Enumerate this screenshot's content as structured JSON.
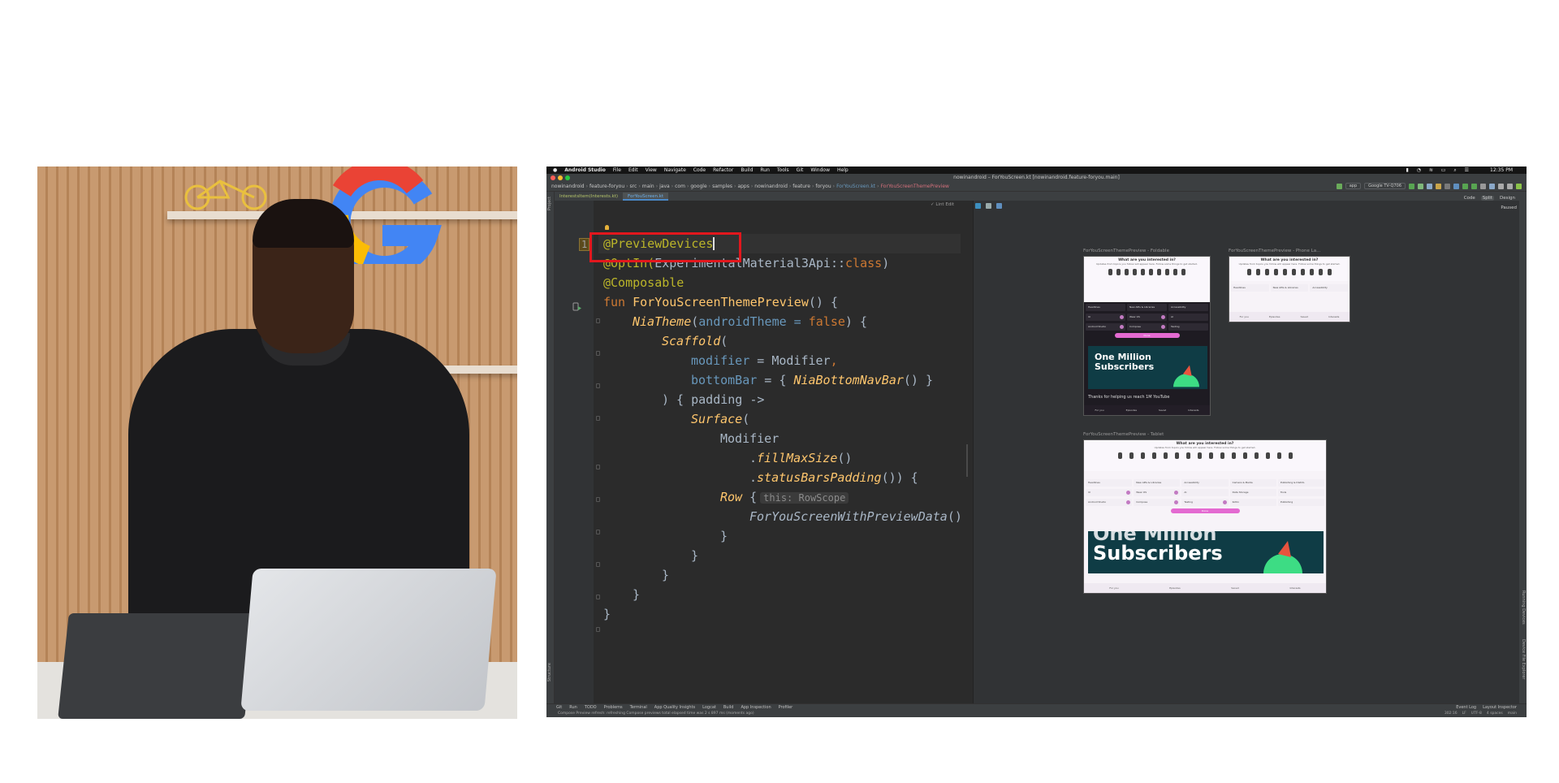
{
  "presenter": {
    "alt": "Presenter standing at a laptop in front of a wooden shelf with a Google logo"
  },
  "menubar": {
    "app": "Android Studio",
    "items": [
      "File",
      "Edit",
      "View",
      "Navigate",
      "Code",
      "Refactor",
      "Build",
      "Run",
      "Tools",
      "Git",
      "Window",
      "Help"
    ],
    "clock": "12:35 PM"
  },
  "window": {
    "title": "nowinandroid – ForYouScreen.kt [nowinandroid.feature-foryou.main]"
  },
  "navbar": {
    "crumbs": [
      "nowinandroid",
      "feature-foryou",
      "src",
      "main",
      "java",
      "com",
      "google",
      "samples",
      "apps",
      "nowinandroid",
      "feature",
      "foryou"
    ],
    "file": "ForYouScreen.kt",
    "function": "ForYouScreenThemePreview",
    "run_config": "app",
    "device": "Google TV-Q706"
  },
  "tabs": [
    {
      "label": "InterestsItem(Interests.kt)",
      "active": false
    },
    {
      "label": "ForYouScreen.kt",
      "active": true
    }
  ],
  "left_strip": {
    "project": "Project",
    "structure": "Structure"
  },
  "right_strip": {
    "running_devices": "Running Devices",
    "emulator": "Device File Explorer"
  },
  "editor": {
    "lint_edit": "✓ Lint Edit",
    "line_number": "1",
    "lines": {
      "l1": "@PreviewDevices",
      "l2a": "@OptIn(",
      "l2b": "ExperimentalMaterial3Api",
      "l2c": "::",
      "l2d": "class",
      "l2e": ")",
      "l3": "@Composable",
      "l4a": "fun ",
      "l4b": "ForYouScreenThemePreview",
      "l4c": "() {",
      "l5a": "NiaTheme",
      "l5b": "(",
      "l5c": "androidTheme",
      "l5d": " = ",
      "l5e": "false",
      "l5f": ") {",
      "l6a": "Scaffold",
      "l6b": "(",
      "l7a": "modifier",
      "l7b": " = Modifier",
      "l7c": ",",
      "l8a": "bottomBar",
      "l8b": " = { ",
      "l8c": "NiaBottomNavBar",
      "l8d": "() }",
      "l9": ") { padding ->",
      "l10a": "Surface",
      "l10b": "(",
      "l11": "Modifier",
      "l12a": ".",
      "l12b": "fillMaxSize",
      "l12c": "()",
      "l13a": ".",
      "l13b": "statusBarsPadding",
      "l13c": "()) {",
      "l14a": "Row",
      "l14b": " {",
      "l14hint": "this: RowScope",
      "l15a": "ForYouScreenWithPreviewData",
      "l15b": "()",
      "l16": "}",
      "l17": "}",
      "l18": "}",
      "l19": "}",
      "l20": "}"
    }
  },
  "preview": {
    "view_modes": [
      "Code",
      "Split",
      "Design"
    ],
    "paused": "Paused",
    "foldable_label": "ForYouScreenThemePreview - Foldable",
    "phone_label": "ForYouScreenThemePreview - Phone La...",
    "tablet_label": "ForYouScreenThemePreview - Tablet",
    "question": "What are you interested in?",
    "question_sub": "Updates from topics you follow will appear here. Follow some things to get started.",
    "topics": [
      "Headlines",
      "New APIs & Libraries",
      "Accessibility",
      "Camera & Media",
      "Publishing & Distrib.",
      "UI",
      "Wear OS",
      "AI",
      "Data Storage",
      "Tools",
      "Android Studio",
      "Compose",
      "Testing",
      "Kotlin",
      "Publishing"
    ],
    "done": "Done",
    "promo_line1": "One Million",
    "promo_line2": "Subscribers",
    "promo_caption": "Thanks for helping us reach 1M YouTube",
    "nav": [
      "For you",
      "Episodes",
      "Saved",
      "Interests"
    ]
  },
  "status_tools": {
    "left": [
      "Git",
      "Run",
      "TODO",
      "Problems",
      "Terminal",
      "App Quality Insights",
      "Logcat",
      "Build",
      "App Inspection",
      "Profiler"
    ],
    "right": [
      "Event Log",
      "Layout Inspector"
    ]
  },
  "status_bar": {
    "message": "Compose Preview refresh: refreshing Compose previews total elapsed time was 2 s 897 ms (moments ago)",
    "position": "302:16",
    "line_sep": "LF",
    "encoding": "UTF-8",
    "indent": "4 spaces",
    "branch": "main"
  },
  "colors": {
    "highlight": "#e2171d",
    "editor_bg": "#2b2b2b",
    "keyword": "#cc7832",
    "annotation": "#bbb529",
    "function": "#ffc66d",
    "param": "#6897bb"
  }
}
